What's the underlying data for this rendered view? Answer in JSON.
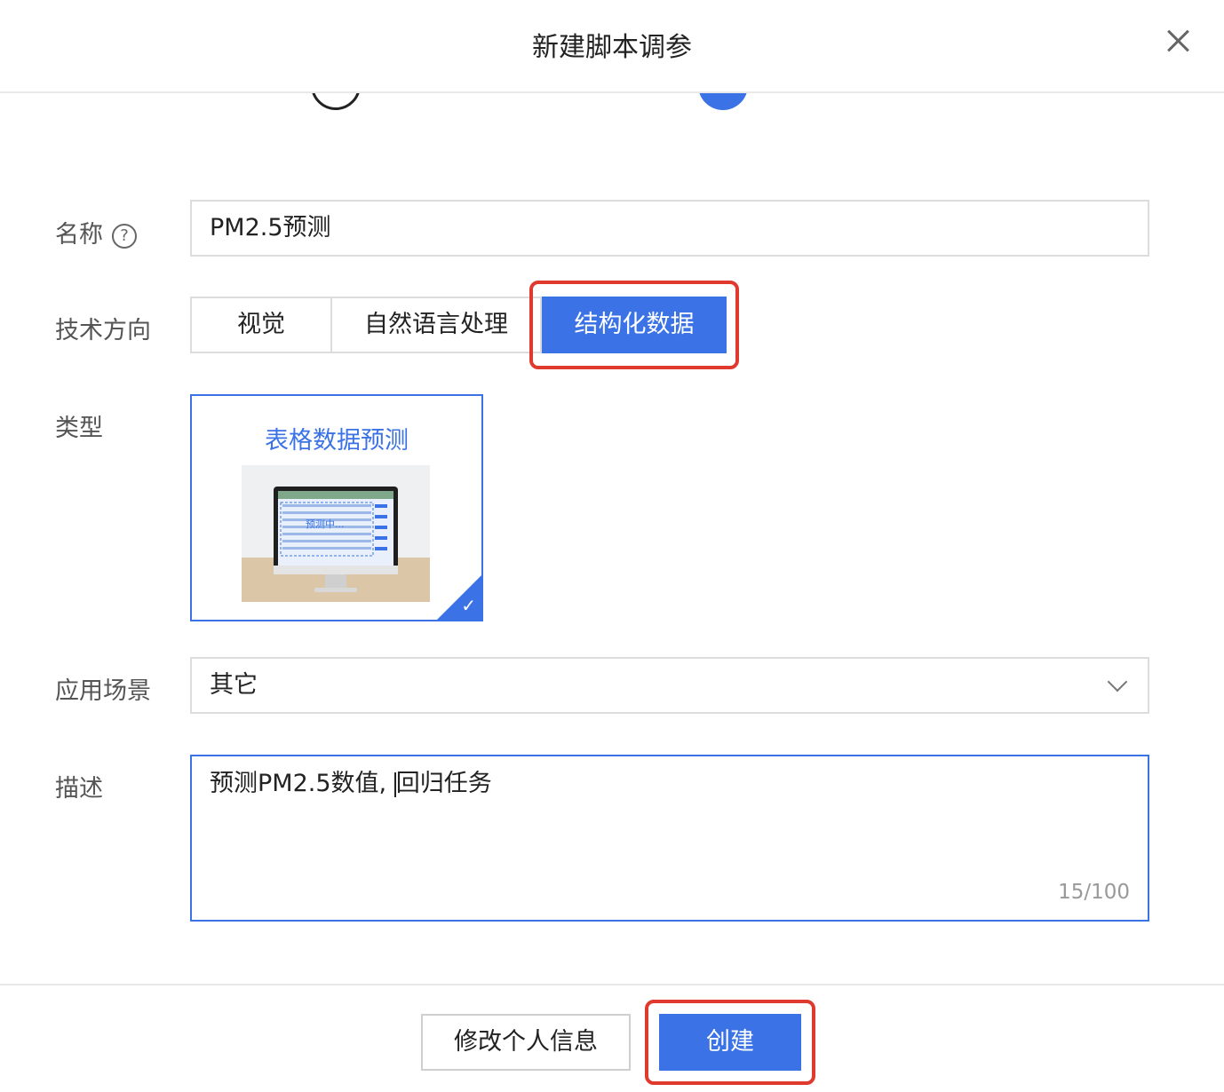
{
  "dialog": {
    "title": "新建脚本调参"
  },
  "form": {
    "name": {
      "label": "名称",
      "help": "?",
      "value": "PM2.5预测"
    },
    "direction": {
      "label": "技术方向",
      "options": [
        "视觉",
        "自然语言处理",
        "结构化数据"
      ],
      "selected": "结构化数据"
    },
    "type": {
      "label": "类型",
      "card_title": "表格数据预测",
      "image_text": "预测中..."
    },
    "scene": {
      "label": "应用场景",
      "value": "其它"
    },
    "description": {
      "label": "描述",
      "value_before": "预测PM2.5数值,",
      "value_after": "回归任务",
      "counter": "15/100"
    }
  },
  "footer": {
    "secondary_label": "修改个人信息",
    "primary_label": "创建"
  },
  "colors": {
    "accent": "#3b73e6",
    "highlight": "#e03a2f"
  }
}
